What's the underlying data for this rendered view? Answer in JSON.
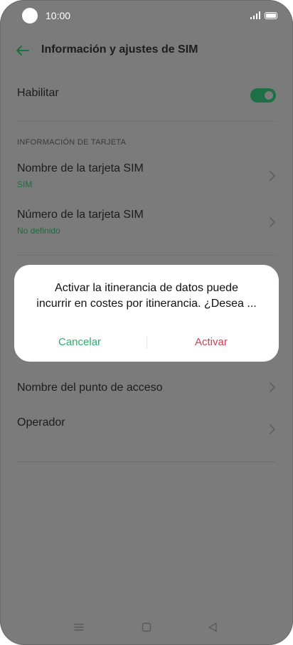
{
  "status_bar": {
    "time": "10:00"
  },
  "header": {
    "title": "Información y ajustes de SIM"
  },
  "settings": {
    "enable_label": "Habilitar",
    "enable_state": "on",
    "section_card_info": "INFORMACIÓN DE TARJETA",
    "sim_name_label": "Nombre de la tarjeta SIM",
    "sim_name_value": "SIM",
    "sim_number_label": "Número de la tarjeta SIM",
    "sim_number_value": "No definido",
    "apn_label": "Nombre del punto de acceso",
    "operator_label": "Operador"
  },
  "dialog": {
    "message_line1": "Activar la itinerancia de datos puede",
    "message_line2": "incurrir en costes por itinerancia. ¿Desea ...",
    "cancel_label": "Cancelar",
    "activate_label": "Activar"
  },
  "colors": {
    "accent_green": "#1d7046",
    "link_green": "#2fae6c",
    "danger_red": "#d53c4e",
    "scrim_gray": "#7b7b7b"
  },
  "icons": [
    "back-arrow-icon",
    "chevron-right-icon",
    "menu-icon",
    "home-square-icon",
    "back-triangle-icon"
  ]
}
